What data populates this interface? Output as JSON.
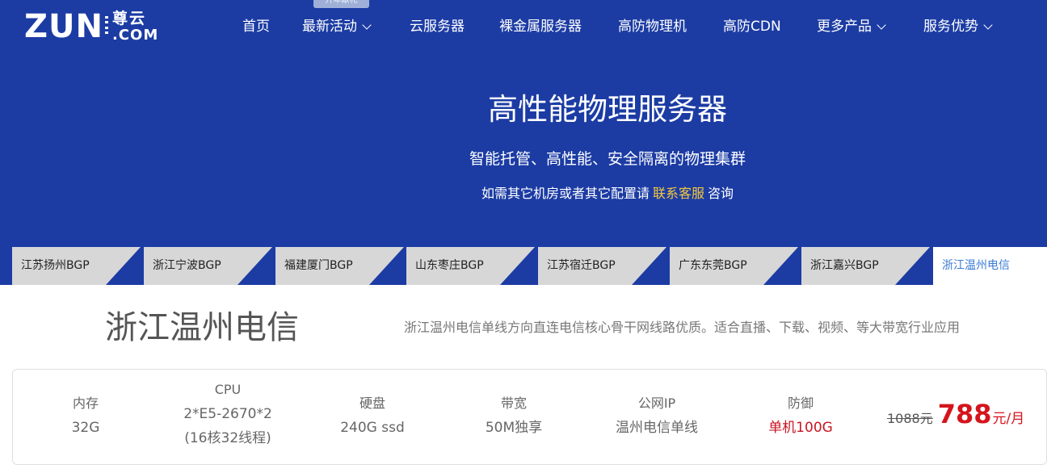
{
  "brand": {
    "logo_main": "ZUN",
    "logo_cn": "尊云",
    "logo_com": ".COM"
  },
  "nav": {
    "items": [
      {
        "label": "首页",
        "dropdown": false
      },
      {
        "label": "最新活动",
        "dropdown": true
      },
      {
        "label": "云服务器",
        "dropdown": false
      },
      {
        "label": "裸金属服务器",
        "dropdown": false
      },
      {
        "label": "高防物理机",
        "dropdown": false
      },
      {
        "label": "高防CDN",
        "dropdown": false
      },
      {
        "label": "更多产品",
        "dropdown": true
      },
      {
        "label": "服务优势",
        "dropdown": true
      }
    ],
    "badge": "开年献礼"
  },
  "hero": {
    "title": "高性能物理服务器",
    "subtitle": "智能托管、高性能、安全隔离的物理集群",
    "contact_prefix": "如需其它机房或者其它配置请",
    "contact_link": "联系客服",
    "contact_suffix": "咨询"
  },
  "tabs": [
    {
      "label": "江苏扬州BGP",
      "active": false
    },
    {
      "label": "浙江宁波BGP",
      "active": false
    },
    {
      "label": "福建厦门BGP",
      "active": false
    },
    {
      "label": "山东枣庄BGP",
      "active": false
    },
    {
      "label": "江苏宿迁BGP",
      "active": false
    },
    {
      "label": "广东东莞BGP",
      "active": false
    },
    {
      "label": "浙江嘉兴BGP",
      "active": false
    },
    {
      "label": "浙江温州电信",
      "active": true
    }
  ],
  "region": {
    "title": "浙江温州电信",
    "description": "浙江温州电信单线方向直连电信核心骨干网线路优质。适合直播、下载、视频、等大带宽行业应用"
  },
  "product": {
    "memory": {
      "label": "内存",
      "value": "32G"
    },
    "cpu": {
      "label": "CPU",
      "value": "2*E5-2670*2",
      "detail": "(16核32线程)"
    },
    "disk": {
      "label": "硬盘",
      "value": "240G ssd"
    },
    "bandwidth": {
      "label": "带宽",
      "value": "50M独享"
    },
    "ip": {
      "label": "公网IP",
      "value": "温州电信单线"
    },
    "defense": {
      "label": "防御",
      "value": "单机100G"
    },
    "price": {
      "old": "1088元",
      "current": "788",
      "unit": "元/月"
    }
  },
  "colors": {
    "hero_bg": "#1c3ca4",
    "accent_link": "#f6c93c",
    "price_red": "#d4141c",
    "active_tab_text": "#3a7bd5"
  }
}
